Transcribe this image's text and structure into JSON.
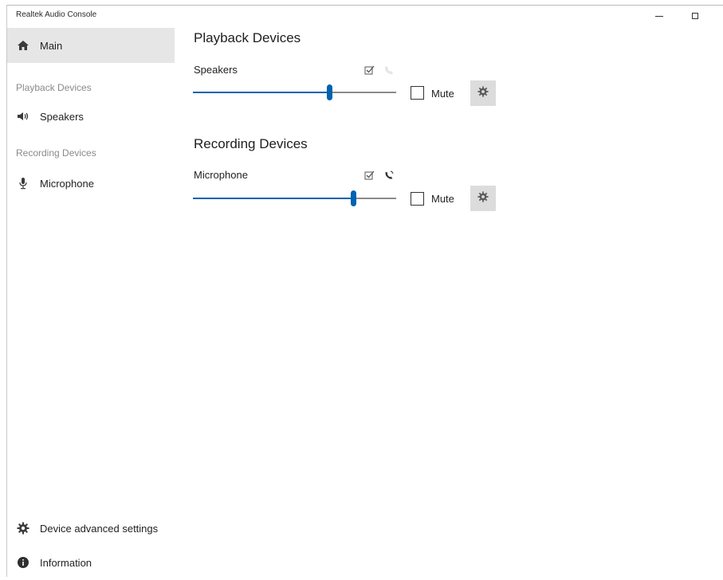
{
  "window": {
    "title": "Realtek Audio Console"
  },
  "sidebar": {
    "main_label": "Main",
    "playback_header": "Playback Devices",
    "speakers_label": "Speakers",
    "recording_header": "Recording Devices",
    "microphone_label": "Microphone",
    "advanced_label": "Device advanced settings",
    "information_label": "Information"
  },
  "playback": {
    "title": "Playback Devices",
    "device_name": "Speakers",
    "volume_fraction": 0.67,
    "mute_label": "Mute",
    "muted": false
  },
  "recording": {
    "title": "Recording Devices",
    "device_name": "Microphone",
    "volume_fraction": 0.79,
    "mute_label": "Mute",
    "muted": false
  },
  "colors": {
    "accent": "#0063b1",
    "selected_bg": "#e6e6e6",
    "gear_bg": "#dcdcdc"
  }
}
